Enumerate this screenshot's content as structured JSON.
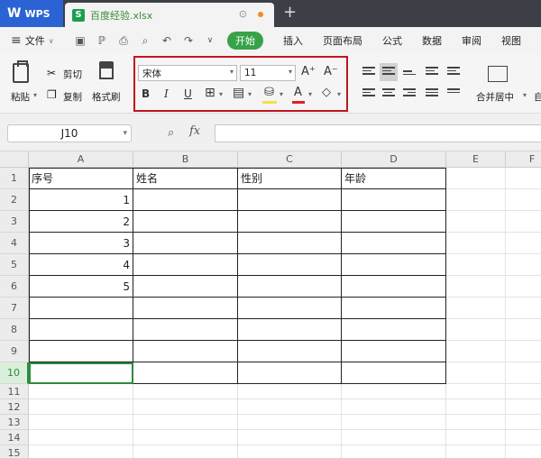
{
  "app": {
    "brand": "WPS",
    "file_tab": "百度经验.xlsx"
  },
  "menu": {
    "file": "文件",
    "start": "开始",
    "items": [
      "插入",
      "页面布局",
      "公式",
      "数据",
      "审阅",
      "视图"
    ]
  },
  "ribbon": {
    "cut": "剪切",
    "copy": "复制",
    "paste": "粘贴",
    "format_painter": "格式刷",
    "font_name": "宋体",
    "font_size": "11",
    "grow_font": "A⁺",
    "shrink_font": "A⁻",
    "bold": "B",
    "italic": "I",
    "underline": "U",
    "font_color_letter": "A",
    "merge_center": "合并居中",
    "auto": "自"
  },
  "formula_bar": {
    "cell_ref": "J10",
    "fx": "fx",
    "value": ""
  },
  "grid": {
    "columns": [
      "A",
      "B",
      "C",
      "D",
      "E",
      "F"
    ],
    "rows": [
      "1",
      "2",
      "3",
      "4",
      "5",
      "6",
      "7",
      "8",
      "9",
      "10",
      "11",
      "12",
      "13",
      "14",
      "15"
    ],
    "active_row": "10",
    "cells": {
      "A1": "序号",
      "B1": "姓名",
      "C1": "性别",
      "D1": "年龄",
      "A2": "1",
      "A3": "2",
      "A4": "3",
      "A5": "4",
      "A6": "5"
    }
  },
  "colors": {
    "accent_green": "#37a24a",
    "wps_blue": "#2b63d4",
    "highlight_red": "#c0161f"
  }
}
